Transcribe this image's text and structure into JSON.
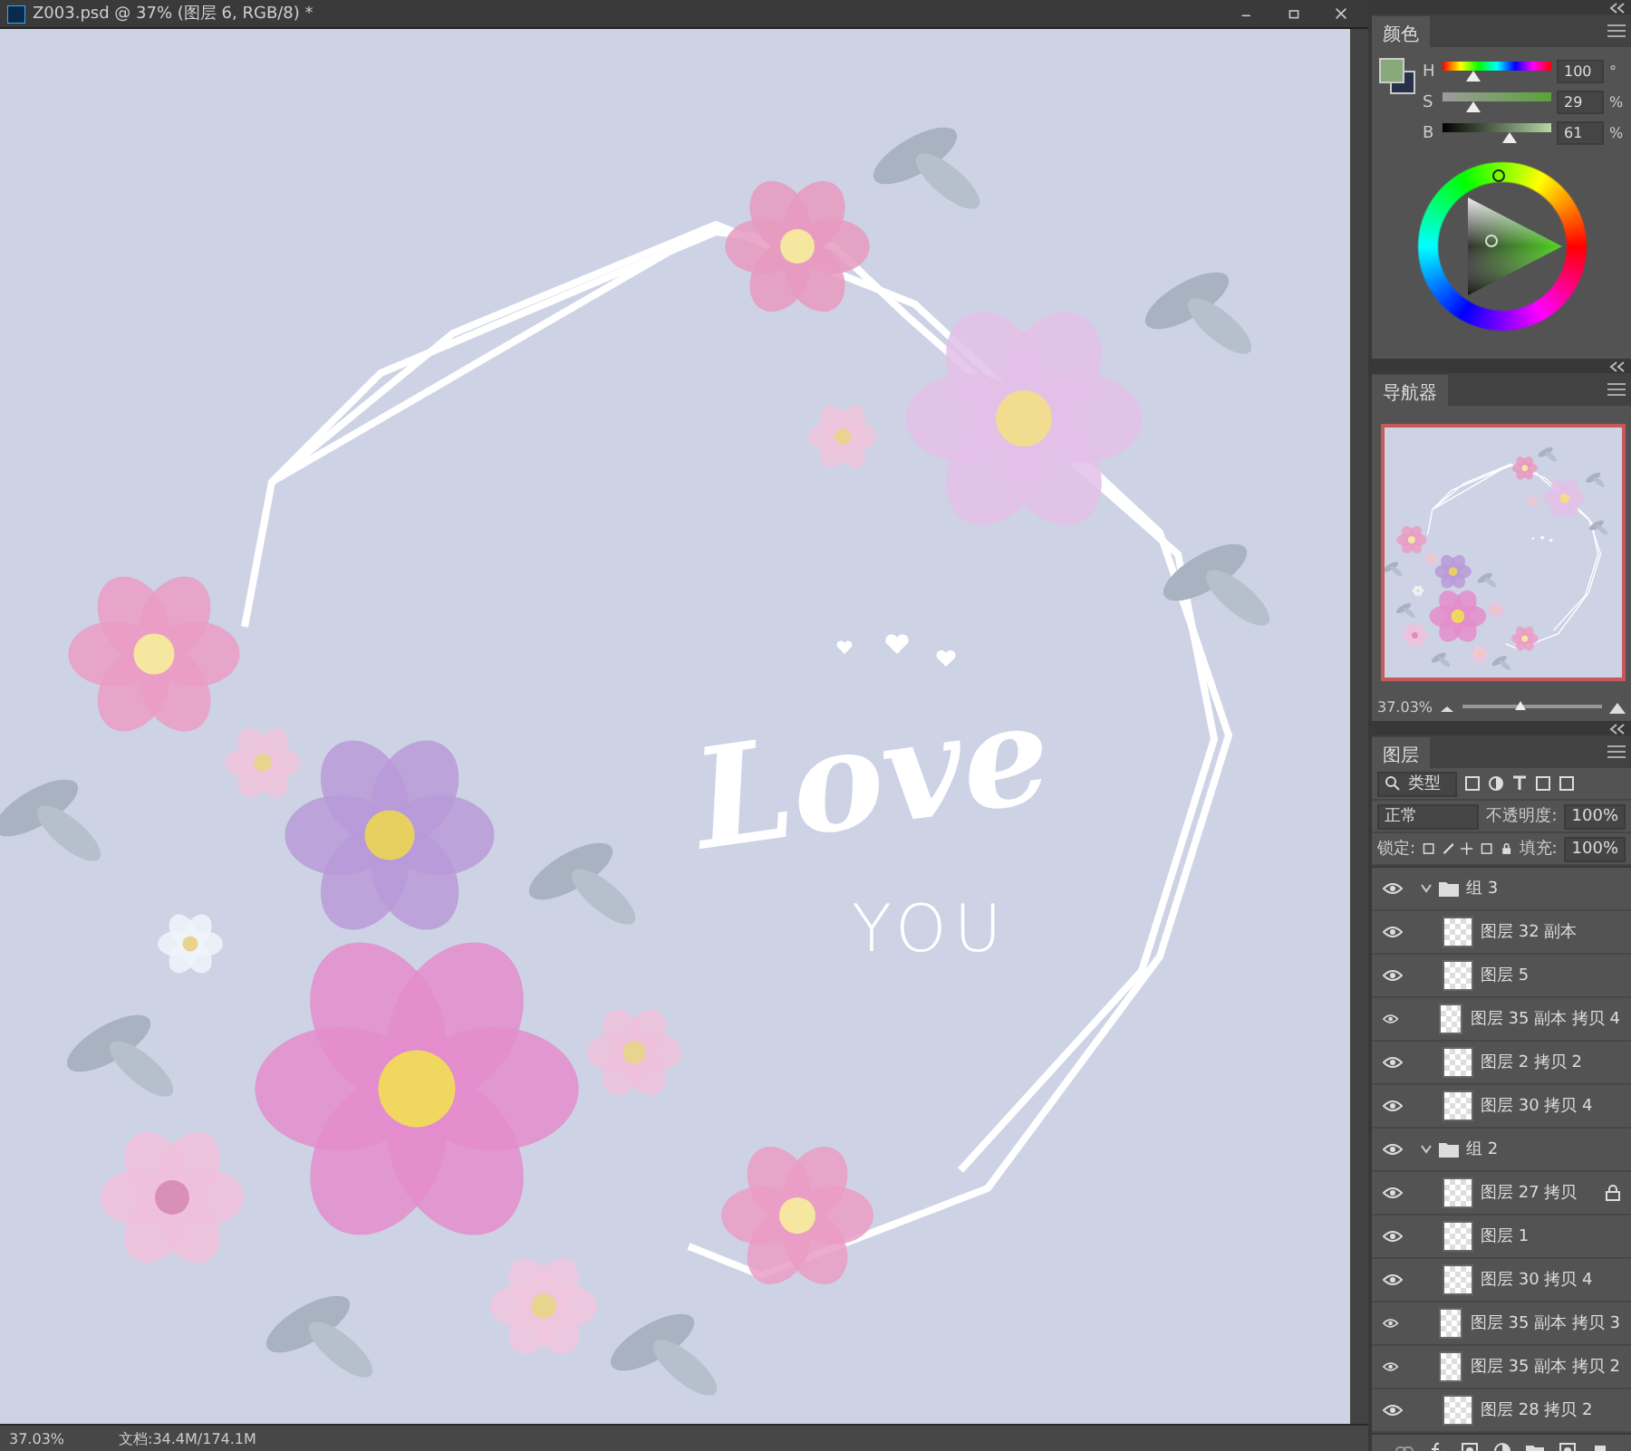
{
  "document": {
    "title": "Z003.psd @ 37% (图层 6, RGB/8) *",
    "artwork": {
      "headline": "Love",
      "subline": "YOU"
    },
    "status_bar": {
      "zoom": "37.03%",
      "doc_size": "文档:34.4M/174.1M"
    }
  },
  "color_panel": {
    "tab": "颜色",
    "sliders": [
      {
        "label": "H",
        "value": "100",
        "unit": "°",
        "level": 0.28,
        "kind": "hue"
      },
      {
        "label": "S",
        "value": "29",
        "unit": "%",
        "level": 0.29,
        "kind": "saturation"
      },
      {
        "label": "B",
        "value": "61",
        "unit": "%",
        "level": 0.61,
        "kind": "brightness"
      }
    ]
  },
  "navigator": {
    "tab": "导航器",
    "zoom": "37.03%",
    "level": 0.42
  },
  "layers_panel": {
    "tab": "图层",
    "filter": "类型",
    "blend_mode": "正常",
    "opacity_label": "不透明度:",
    "opacity": "100%",
    "lock_label": "锁定:",
    "fill_label": "填充:",
    "fill": "100%",
    "layers": [
      {
        "kind": "group",
        "name": "组 3",
        "visible": true,
        "expanded": true,
        "children": [
          {
            "kind": "layer",
            "name": "图层 32 副本",
            "visible": true,
            "locked": false
          },
          {
            "kind": "layer",
            "name": "图层 5",
            "visible": true,
            "locked": false
          },
          {
            "kind": "layer",
            "name": "图层 35 副本 拷贝 4",
            "visible": true,
            "locked": false
          },
          {
            "kind": "layer",
            "name": "图层 2 拷贝 2",
            "visible": true,
            "locked": false
          },
          {
            "kind": "layer",
            "name": "图层 30 拷贝 4",
            "visible": true,
            "locked": false
          }
        ]
      },
      {
        "kind": "group",
        "name": "组 2",
        "visible": true,
        "expanded": true,
        "children": [
          {
            "kind": "layer",
            "name": "图层 27 拷贝",
            "visible": true,
            "locked": true
          },
          {
            "kind": "layer",
            "name": "图层 1",
            "visible": true,
            "locked": false
          },
          {
            "kind": "layer",
            "name": "图层 30 拷贝 4",
            "visible": true,
            "locked": false
          },
          {
            "kind": "layer",
            "name": "图层 35 副本 拷贝 3",
            "visible": true,
            "locked": false
          },
          {
            "kind": "layer",
            "name": "图层 35 副本 拷贝 2",
            "visible": true,
            "locked": false
          },
          {
            "kind": "layer",
            "name": "图层 28 拷贝 2",
            "visible": true,
            "locked": false
          }
        ]
      }
    ]
  }
}
